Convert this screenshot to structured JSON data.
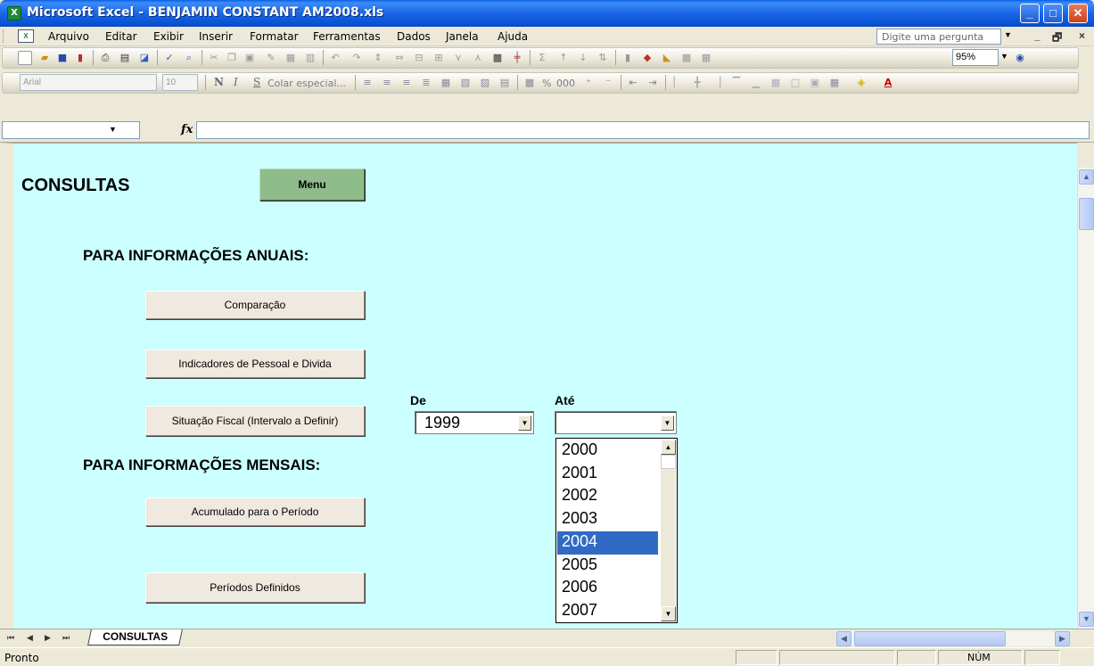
{
  "window": {
    "title": "Microsoft Excel - BENJAMIN CONSTANT AM2008.xls",
    "controls": {
      "minimize": "_",
      "maximize": "□",
      "close": "✕"
    }
  },
  "menubar": {
    "items": [
      "Arquivo",
      "Editar",
      "Exibir",
      "Inserir",
      "Formatar",
      "Ferramentas",
      "Dados",
      "Janela",
      "Ajuda"
    ],
    "help_placeholder": "Digite uma pergunta",
    "mdi_controls": [
      "_",
      "🗗",
      "×"
    ]
  },
  "toolbar_standard": {
    "zoom": "95%"
  },
  "toolbar_formatting": {
    "font": "Arial",
    "size": "10",
    "bold": "N",
    "italic": "I",
    "underline": "S",
    "paste_special": "Colar especial...",
    "percent": "%",
    "thousands": "000"
  },
  "formulabar": {
    "fx": "fx"
  },
  "sheet": {
    "title": "CONSULTAS",
    "menu_button": "Menu",
    "annual_heading": "PARA INFORMAÇÕES ANUAIS:",
    "monthly_heading": "PARA INFORMAÇÕES MENSAIS:",
    "buttons": {
      "comparacao": "Comparação",
      "indicadores": "Indicadores de Pessoal e Divida",
      "situacao": "Situação Fiscal (Intervalo a Definir)",
      "acumulado": "Acumulado para o Período",
      "periodos": "Períodos Definidos"
    },
    "from_label": "De",
    "to_label": "Até",
    "from_value": "1999",
    "to_value": "",
    "to_options": [
      "2000",
      "2001",
      "2002",
      "2003",
      "2004",
      "2005",
      "2006",
      "2007"
    ],
    "to_highlighted": "2004"
  },
  "tabs": {
    "active": "CONSULTAS"
  },
  "status": {
    "left": "Pronto",
    "num": "NÚM"
  }
}
